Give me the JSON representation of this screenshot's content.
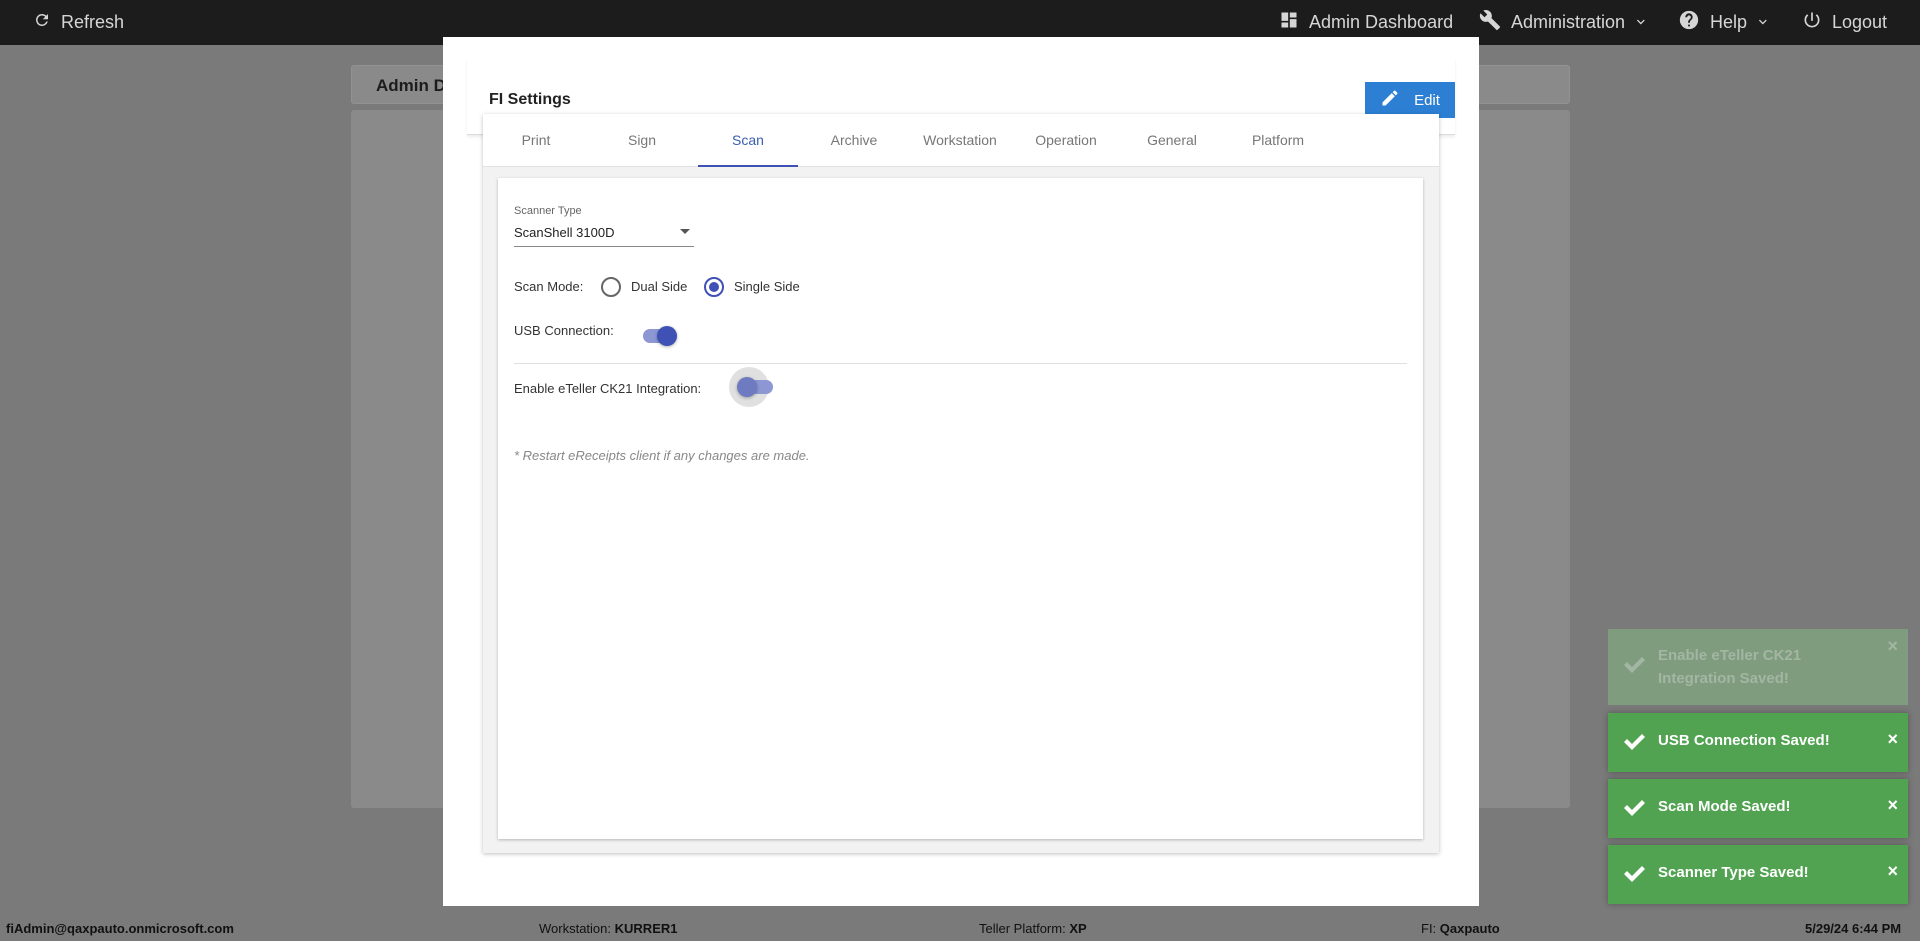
{
  "topbar": {
    "refresh_label": "Refresh",
    "admin_dashboard_label": "Admin Dashboard",
    "administration_label": "Administration",
    "help_label": "Help",
    "logout_label": "Logout"
  },
  "background": {
    "page_header_label": "Admin D"
  },
  "modal": {
    "title": "FI Settings",
    "edit_label": "Edit",
    "tabs": [
      {
        "label": "Print"
      },
      {
        "label": "Sign"
      },
      {
        "label": "Scan"
      },
      {
        "label": "Archive"
      },
      {
        "label": "Workstation"
      },
      {
        "label": "Operation"
      },
      {
        "label": "General"
      },
      {
        "label": "Platform"
      }
    ],
    "active_tab": "Scan",
    "scan": {
      "scanner_type_label": "Scanner Type",
      "scanner_type_value": "ScanShell 3100D",
      "scan_mode_label": "Scan Mode:",
      "scan_mode_options": [
        "Dual Side",
        "Single Side"
      ],
      "scan_mode_selected": "Single Side",
      "usb_connection_label": "USB Connection:",
      "usb_connection_on": true,
      "eteller_label": "Enable eTeller CK21 Integration:",
      "eteller_on": false,
      "note": "* Restart eReceipts client if any changes are made."
    }
  },
  "statusbar": {
    "user": "fiAdmin@qaxpauto.onmicrosoft.com",
    "workstation_label": "Workstation:",
    "workstation_value": "KURRER1",
    "teller_platform_label": "Teller Platform:",
    "teller_platform_value": "XP",
    "fi_label": "FI:",
    "fi_value": "Qaxpauto",
    "datetime": "5/29/24 6:44 PM"
  },
  "toasts": [
    {
      "message": "Enable eTeller CK21 Integration Saved!"
    },
    {
      "message": "USB Connection Saved!"
    },
    {
      "message": "Scan Mode Saved!"
    },
    {
      "message": "Scanner Type Saved!"
    }
  ],
  "colors": {
    "accent": "#3f51b5",
    "edit_button": "#2d7fd3",
    "toast_success": "#51a351",
    "topbar": "#1c1c1c"
  }
}
